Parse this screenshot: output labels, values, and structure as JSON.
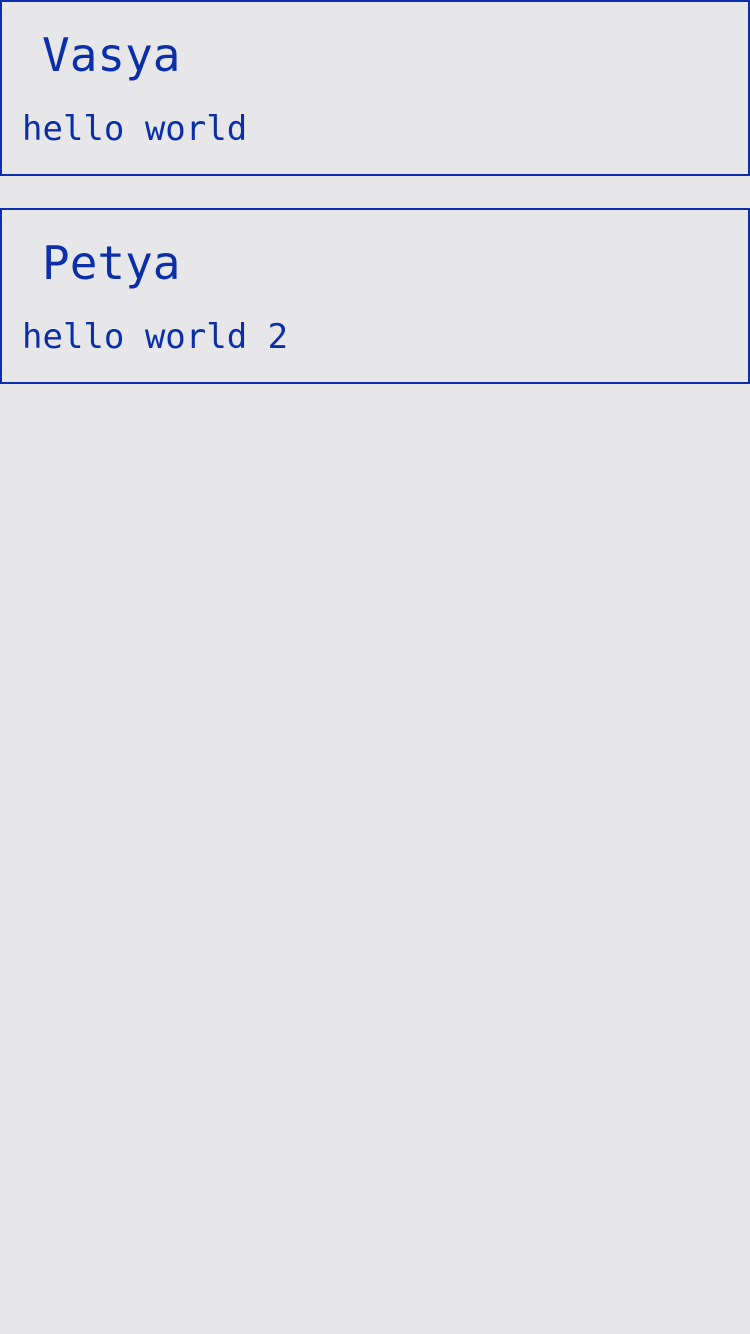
{
  "theme": {
    "background": "#e7e7ea",
    "accent": "#0a2fa8"
  },
  "posts": [
    {
      "author": "Vasya",
      "message": "hello world"
    },
    {
      "author": "Petya",
      "message": "hello world 2"
    }
  ]
}
